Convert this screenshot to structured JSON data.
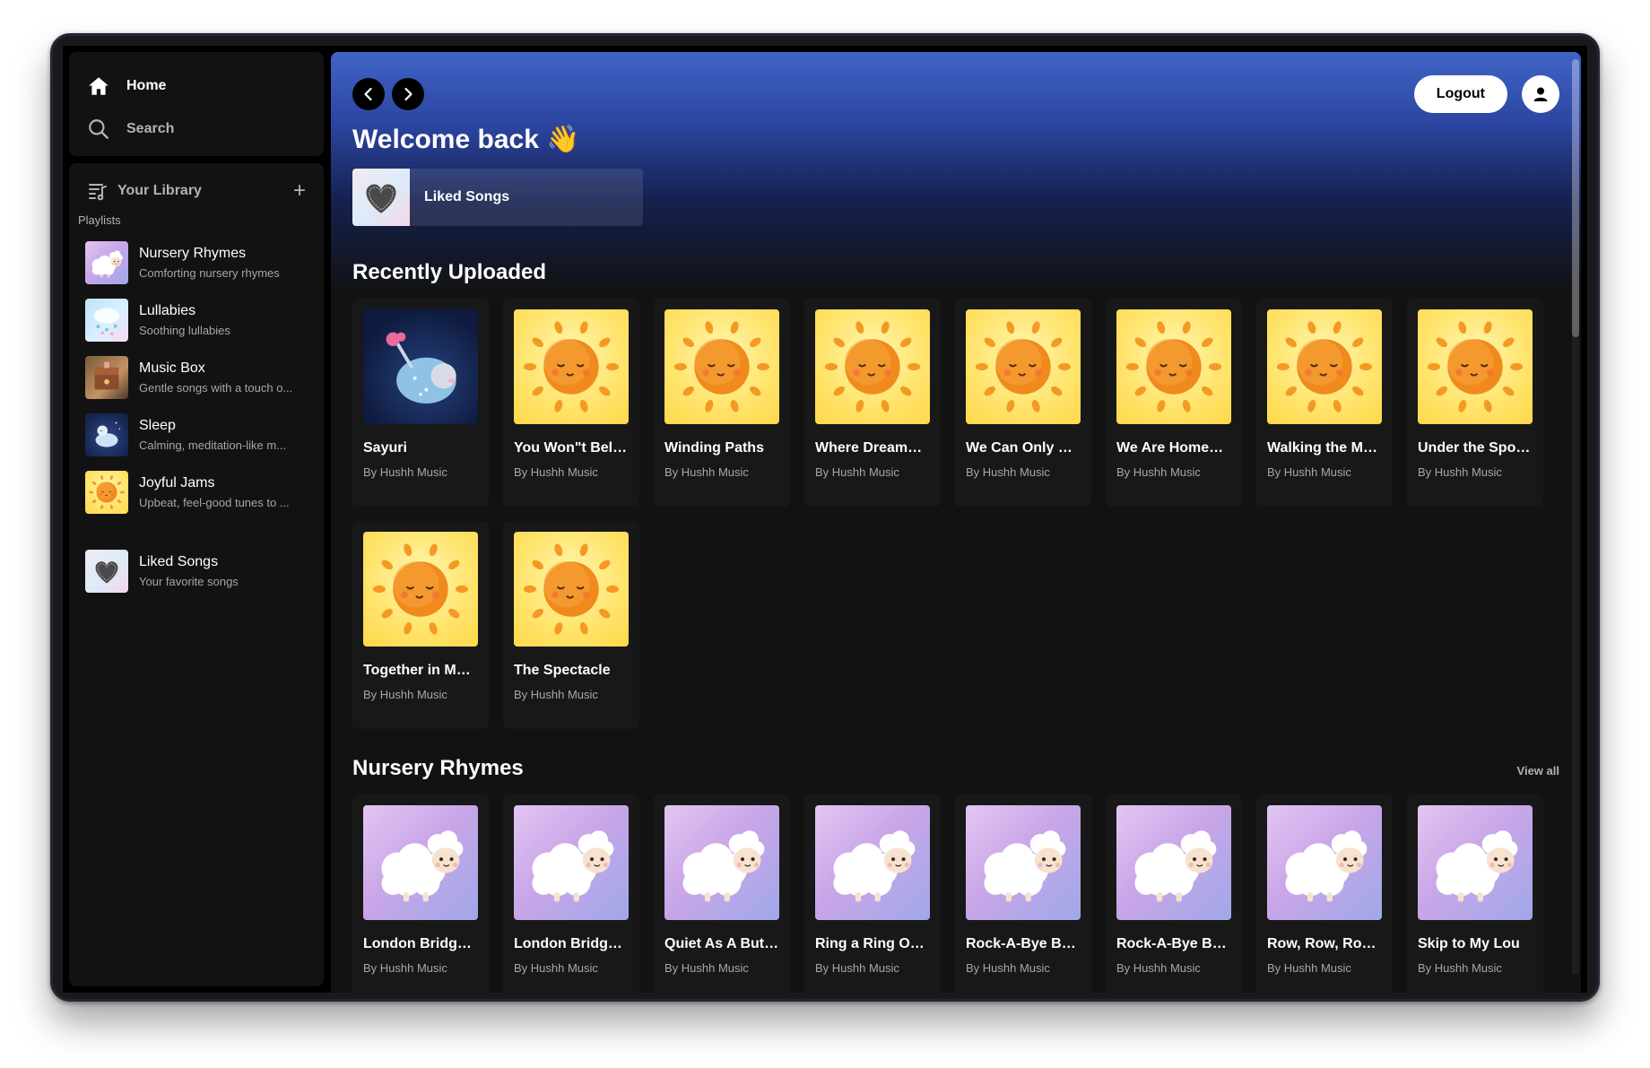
{
  "sidebar": {
    "nav": [
      {
        "label": "Home",
        "icon": "home-icon"
      },
      {
        "label": "Search",
        "icon": "search-icon"
      }
    ],
    "library_label": "Your Library",
    "playlists_heading": "Playlists",
    "playlists": [
      {
        "title": "Nursery Rhymes",
        "subtitle": "Comforting nursery rhymes",
        "art": "sheep"
      },
      {
        "title": "Lullabies",
        "subtitle": "Soothing lullabies",
        "art": "lullabies"
      },
      {
        "title": "Music Box",
        "subtitle": "Gentle songs with a touch o...",
        "art": "musicbox"
      },
      {
        "title": "Sleep",
        "subtitle": "Calming, meditation-like m...",
        "art": "sleep"
      },
      {
        "title": "Joyful Jams",
        "subtitle": "Upbeat, feel-good tunes to ...",
        "art": "sun"
      }
    ],
    "liked": {
      "title": "Liked Songs",
      "subtitle": "Your favorite songs",
      "art": "heart"
    }
  },
  "header": {
    "logout_label": "Logout",
    "welcome": "Welcome back 👋",
    "liked_card_label": "Liked Songs"
  },
  "recent": {
    "title": "Recently Uploaded",
    "items": [
      {
        "title": "Sayuri",
        "artist": "By Hushh Music",
        "art": "sayuri"
      },
      {
        "title": "You Won\"t Belie...",
        "artist": "By Hushh Music",
        "art": "sun"
      },
      {
        "title": "Winding Paths",
        "artist": "By Hushh Music",
        "art": "sun"
      },
      {
        "title": "Where Dreams ...",
        "artist": "By Hushh Music",
        "art": "sun"
      },
      {
        "title": "We Can Only O...",
        "artist": "By Hushh Music",
        "art": "sun"
      },
      {
        "title": "We Are Homew...",
        "artist": "By Hushh Music",
        "art": "sun"
      },
      {
        "title": "Walking the Ma...",
        "artist": "By Hushh Music",
        "art": "sun"
      },
      {
        "title": "Under the Spotl...",
        "artist": "By Hushh Music",
        "art": "sun"
      },
      {
        "title": "Together in Mot...",
        "artist": "By Hushh Music",
        "art": "sun"
      },
      {
        "title": "The Spectacle",
        "artist": "By Hushh Music",
        "art": "sun"
      }
    ]
  },
  "nursery": {
    "title": "Nursery Rhymes",
    "view_all": "View all",
    "items": [
      {
        "title": "London Bridge I...",
        "artist": "By Hushh Music",
        "art": "sheep"
      },
      {
        "title": "London Bridge I...",
        "artist": "By Hushh Music",
        "art": "sheep"
      },
      {
        "title": "Quiet As A Butt...",
        "artist": "By Hushh Music",
        "art": "sheep"
      },
      {
        "title": "Ring a Ring O\" ...",
        "artist": "By Hushh Music",
        "art": "sheep"
      },
      {
        "title": "Rock-A-Bye Ba...",
        "artist": "By Hushh Music",
        "art": "sheep"
      },
      {
        "title": "Rock-A-Bye Baby",
        "artist": "By Hushh Music",
        "art": "sheep"
      },
      {
        "title": "Row, Row, Row ...",
        "artist": "By Hushh Music",
        "art": "sheep"
      },
      {
        "title": "Skip to My Lou",
        "artist": "By Hushh Music",
        "art": "sheep"
      }
    ]
  },
  "colors": {
    "accent": "#3f64c7",
    "surface": "#121212",
    "card": "#181818"
  }
}
